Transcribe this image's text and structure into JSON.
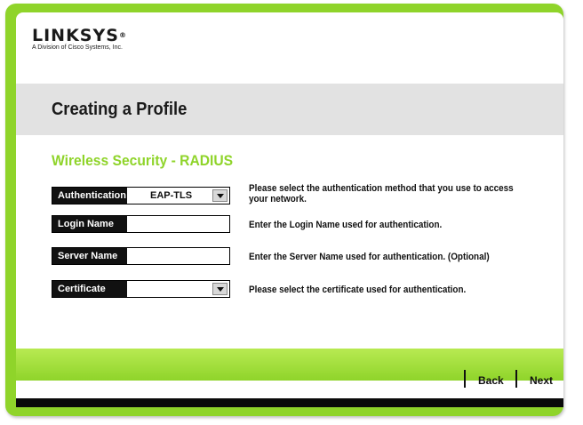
{
  "brand": {
    "logo_text": "LINKSYS",
    "logo_reg": "®",
    "tagline": "A Division of Cisco Systems, Inc."
  },
  "page": {
    "title": "Creating a Profile",
    "section_title": "Wireless Security - RADIUS"
  },
  "fields": {
    "authentication": {
      "label": "Authentication",
      "value": "EAP-TLS",
      "description": "Please select the authentication method that you use to access your network."
    },
    "login_name": {
      "label": "Login Name",
      "value": "",
      "description": "Enter the Login Name used for authentication."
    },
    "server_name": {
      "label": "Server Name",
      "value": "",
      "description": "Enter the Server Name used for authentication.",
      "optional_tag": "(Optional)"
    },
    "certificate": {
      "label": "Certificate",
      "value": "",
      "description": "Please select the certificate used for authentication."
    }
  },
  "nav": {
    "back_label": "Back",
    "next_label": "Next"
  },
  "colors": {
    "accent_green": "#8fd42a",
    "title_band_gray": "#e2e2e2",
    "footer_black": "#0a0a0a"
  }
}
